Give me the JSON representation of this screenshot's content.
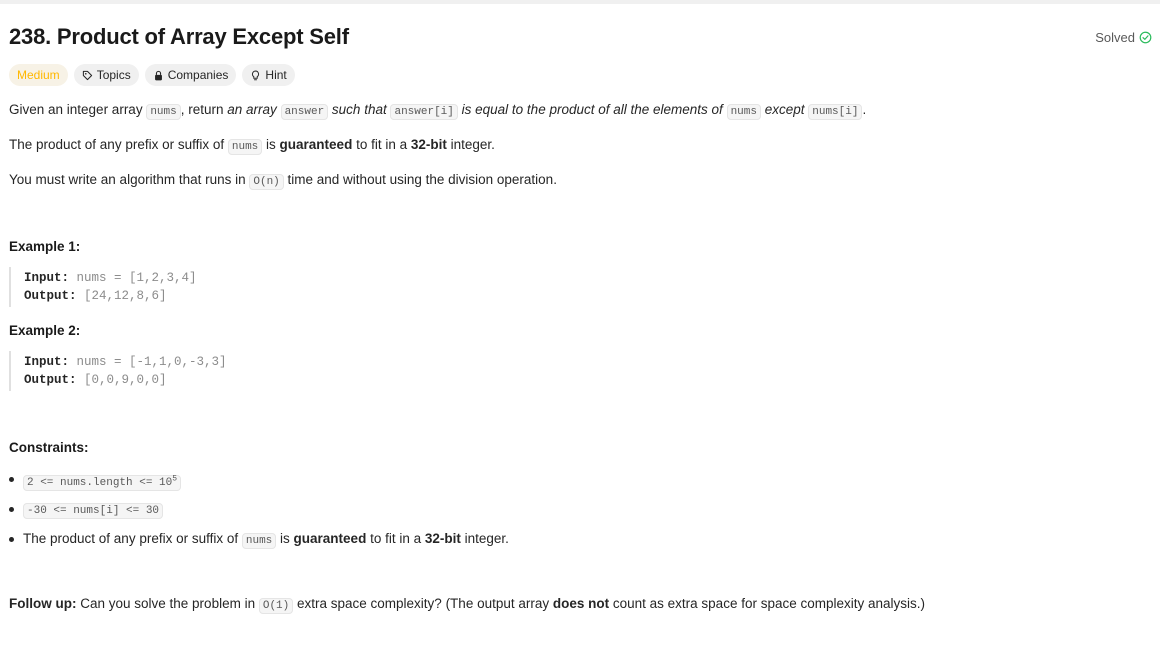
{
  "problem": {
    "title": "238. Product of Array Except Self",
    "status": "Solved",
    "difficulty": "Medium",
    "tags": {
      "topics": "Topics",
      "companies": "Companies",
      "hint": "Hint"
    }
  },
  "description": {
    "p1": {
      "t1": "Given an integer array ",
      "c1": "nums",
      "t2": ", return ",
      "t3": "an array",
      "c2": "answer",
      "t4": " such that ",
      "c3": "answer[i]",
      "t5": " is equal to the product of all the elements of ",
      "c4": "nums",
      "t6": " except ",
      "c5": "nums[i]",
      "t7": "."
    },
    "p2": {
      "t1": "The product of any prefix or suffix of ",
      "c1": "nums",
      "t2": " is ",
      "b1": "guaranteed",
      "t3": " to fit in a ",
      "b2": "32-bit",
      "t4": " integer."
    },
    "p3": {
      "t1": "You must write an algorithm that runs in ",
      "c1": "O(n)",
      "t2": " time and without using the division operation."
    }
  },
  "examples": [
    {
      "title": "Example 1:",
      "input_label": "Input:",
      "input": "nums = [1,2,3,4]",
      "output_label": "Output:",
      "output": "[24,12,8,6]"
    },
    {
      "title": "Example 2:",
      "input_label": "Input:",
      "input": "nums = [-1,1,0,-3,3]",
      "output_label": "Output:",
      "output": "[0,0,9,0,0]"
    }
  ],
  "constraints": {
    "title": "Constraints:",
    "c1_code": "2 <= nums.length <= 10",
    "c1_sup": "5",
    "c2_code": "-30 <= nums[i] <= 30",
    "c3": {
      "t1": "The product of any prefix or suffix of ",
      "c1": "nums",
      "t2": " is ",
      "b1": "guaranteed",
      "t3": " to fit in a ",
      "b2": "32-bit",
      "t4": " integer."
    }
  },
  "followup": {
    "label": "Follow up:",
    "t1": " Can you solve the problem in ",
    "c1": "O(1)",
    "t2": " extra space complexity? (The output array ",
    "b1": "does not",
    "t3": " count as extra space for space complexity analysis.)"
  },
  "colors": {
    "medium": "#ffb800",
    "solved_check": "#2cbb5d"
  },
  "icons": {
    "solved": "check-circle-icon",
    "topics": "tag-icon",
    "companies": "lock-icon",
    "hint": "lightbulb-icon"
  }
}
